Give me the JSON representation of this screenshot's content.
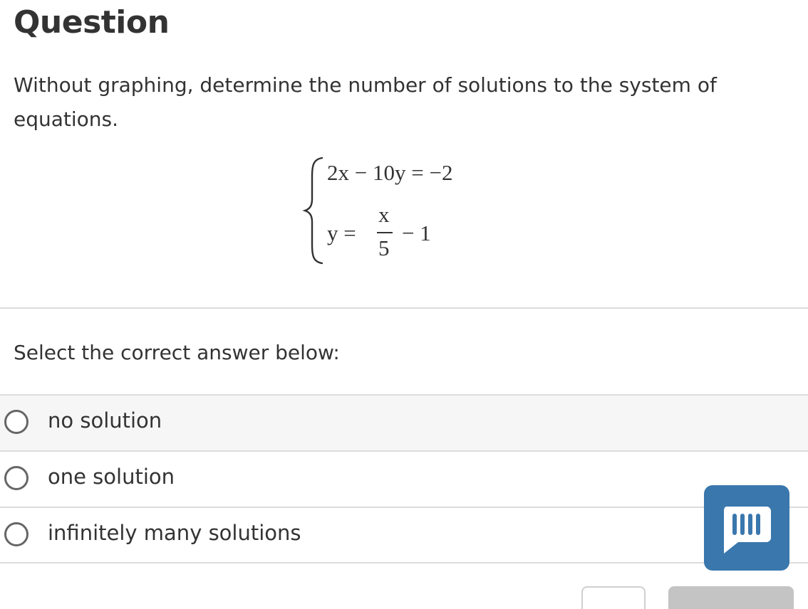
{
  "header": {
    "title": "Question"
  },
  "question": {
    "prompt": "Without graphing, determine the number of solutions to the system of equations."
  },
  "system": {
    "eq1": "2x − 10y = −2",
    "eq2_lhs": "y =",
    "eq2_numerator": "x",
    "eq2_denominator": "5",
    "eq2_rhs": "− 1"
  },
  "answer_section": {
    "label": "Select the correct answer below:",
    "options": [
      {
        "label": "no solution",
        "highlighted": true
      },
      {
        "label": "one solution",
        "highlighted": false
      },
      {
        "label": "infinitely many solutions",
        "highlighted": false
      }
    ]
  },
  "feedback": {
    "icon": "message-icon",
    "color": "#3a77ad"
  }
}
